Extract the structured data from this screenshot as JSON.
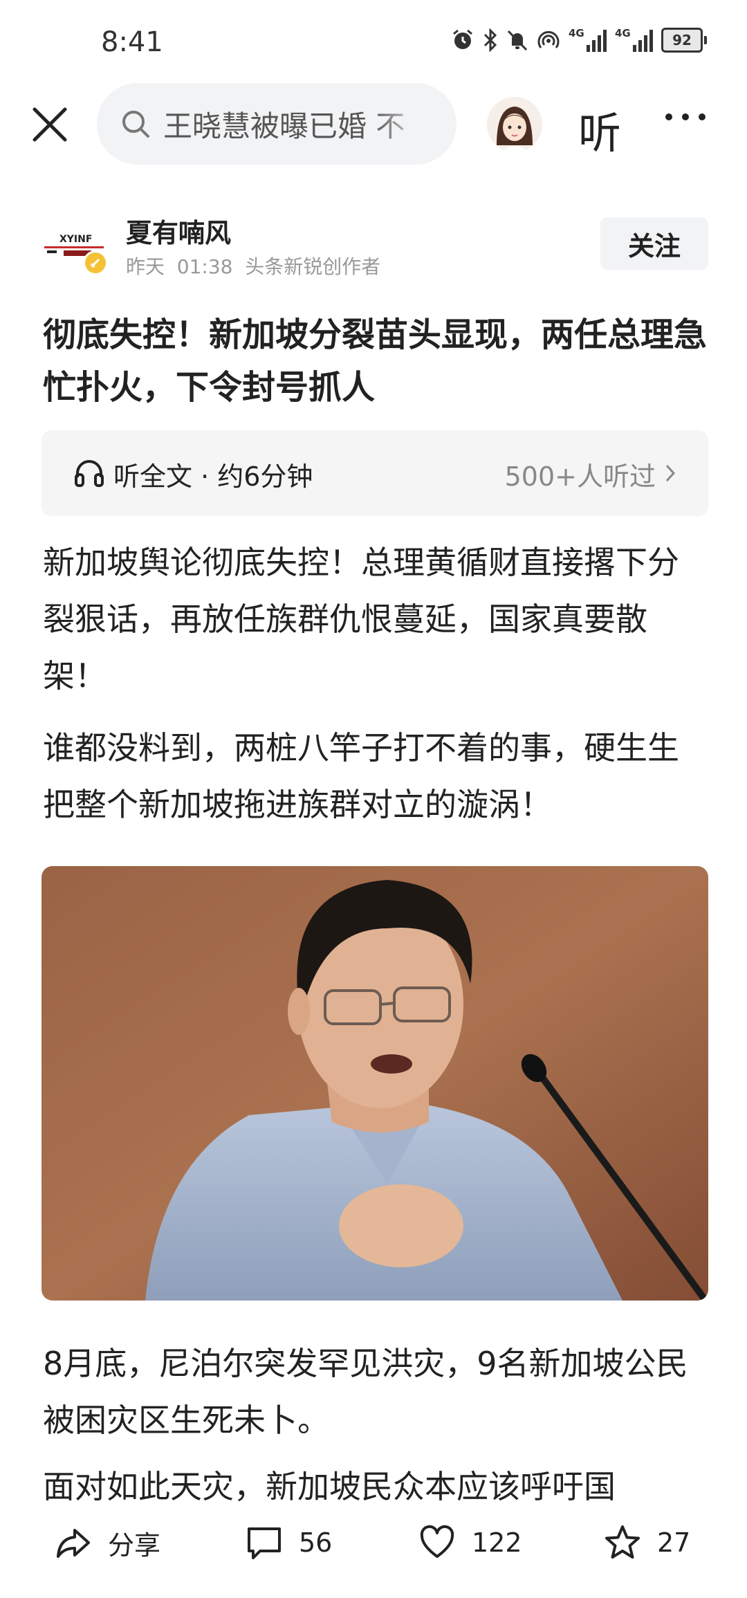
{
  "status_bar": {
    "time": "8:41",
    "network_1": "4G",
    "network_2": "4G",
    "battery": "92"
  },
  "nav": {
    "search_text": "王晓慧被曝已婚 不",
    "listen_label": "听"
  },
  "author": {
    "name": "夏有喃风",
    "logo_text": "XYINF",
    "meta": "昨天  01:38  头条新锐创作者",
    "follow_label": "关注"
  },
  "article": {
    "title": "彻底失控！新加坡分裂苗头显现，两任总理急忙扑火，下令封号抓人",
    "listen_bar": {
      "label": "听全文 · 约6分钟",
      "count": "500+人听过"
    },
    "paragraphs": [
      "新加坡舆论彻底失控！总理黄循财直接撂下分裂狠话，再放任族群仇恨蔓延，国家真要散架！",
      "谁都没料到，两桩八竿子打不着的事，硬生生把整个新加坡拖进族群对立的漩涡！",
      "8月底，尼泊尔突发罕见洪灾，9名新加坡公民被困灾区生死未卜。",
      "面对如此天灾，新加坡民众本应该呼吁国"
    ]
  },
  "actions": {
    "share_label": "分享",
    "comments": "56",
    "likes": "122",
    "favorites": "27"
  }
}
